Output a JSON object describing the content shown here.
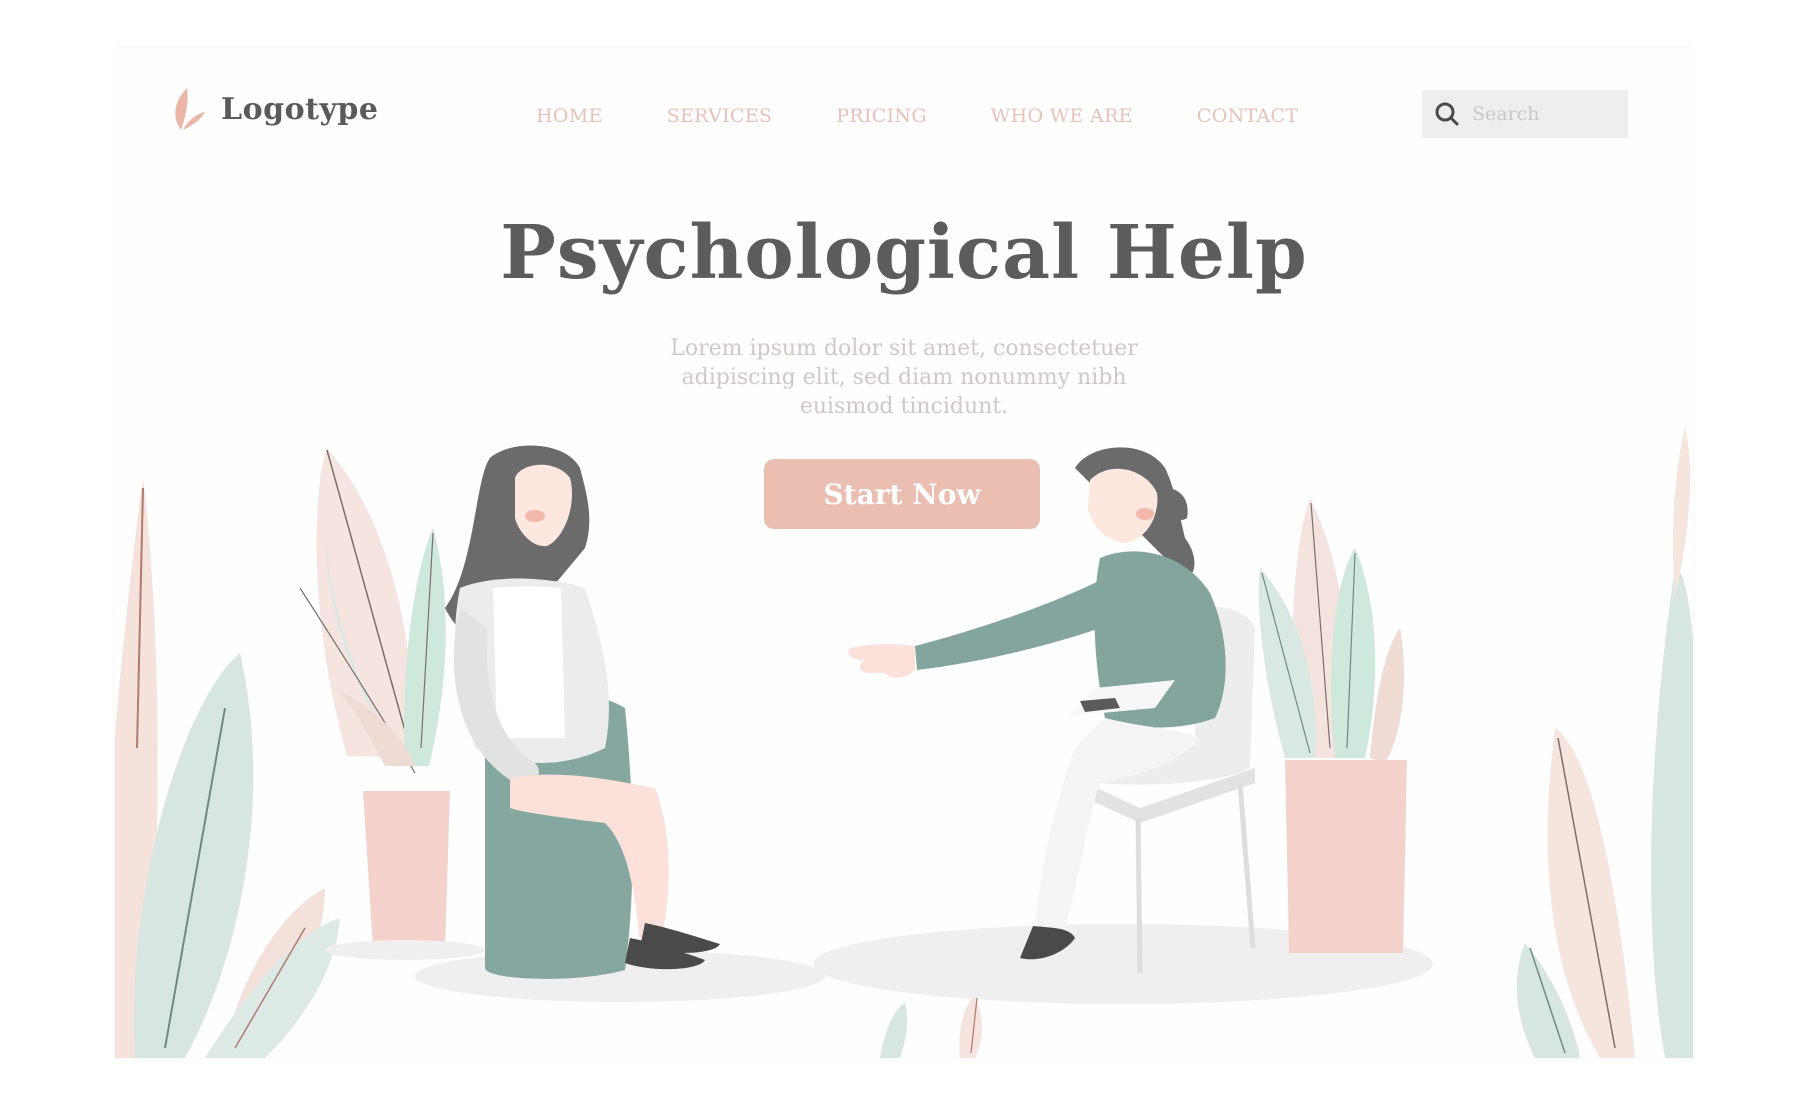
{
  "brand": {
    "name": "Logotype",
    "logo_icon": "leaf-icon"
  },
  "nav": {
    "items": [
      {
        "label": "HOME"
      },
      {
        "label": "SERVICES"
      },
      {
        "label": "PRICING"
      },
      {
        "label": "WHO WE ARE"
      },
      {
        "label": "CONTACT"
      }
    ]
  },
  "search": {
    "placeholder": "Search",
    "icon": "search-icon"
  },
  "hero": {
    "title": "Psychological Help",
    "subtitle": "Lorem ipsum dolor sit amet, consectetuer adipiscing elit, sed diam nonummy nibh euismod tincidunt.",
    "cta_label": "Start Now"
  },
  "colors": {
    "accent": "#ebbeb2",
    "nav_text": "#e8c2b6",
    "title": "#5c5c5c",
    "sage": "#7fa39c",
    "mint": "#cfe7dc",
    "blush": "#f7e6e1"
  }
}
